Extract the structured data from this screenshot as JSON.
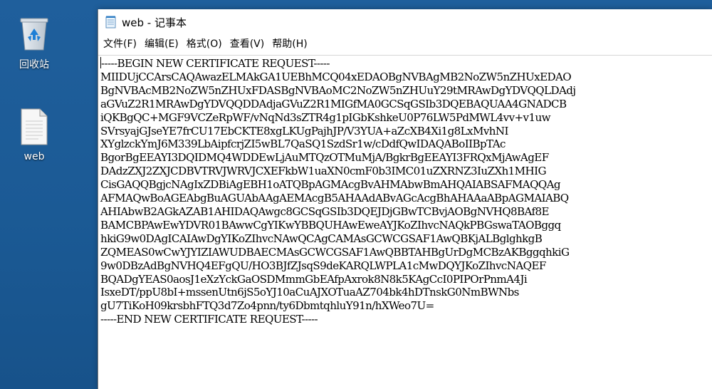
{
  "desktop": {
    "icons": [
      {
        "label": "回收站",
        "icon": "recycle-bin-icon"
      },
      {
        "label": "web",
        "icon": "text-file-icon"
      }
    ]
  },
  "window": {
    "title": "web - 记事本",
    "menu": [
      "文件(F)",
      "编辑(E)",
      "格式(O)",
      "查看(V)",
      "帮助(H)"
    ]
  },
  "document": {
    "lines": [
      "-----BEGIN NEW CERTIFICATE REQUEST-----",
      "MIIDUjCCArsCAQAwazELMAkGA1UEBhMCQ04xEDAOBgNVBAgMB2NoZW5nZHUxEDAO",
      "BgNVBAcMB2NoZW5nZHUxFDASBgNVBAoMC2NoZW5nZHUuY29tMRAwDgYDVQQLDAdj",
      "aGVuZ2R1MRAwDgYDVQQDDAdjaGVuZ2R1MIGfMA0GCSqGSIb3DQEBAQUAA4GNADCB",
      "iQKBgQC+MGF9VCZeRpWF/vNqNd3sZTR4g1pIGbKshkeU0P76LW5PdMWL4vv+v1uw",
      "SVrsyajGJseYE7frCU17EbCKTE8xgLKUgPajhJP/V3YUA+aZcXB4Xi1g8LxMvhNI",
      "XYglzckYmJ6M339LbAipfcrjZI5wBL7QaSQ1SzdSr1w/cDdfQwIDAQABoIIBpTAc",
      "BgorBgEEAYI3DQIDMQ4WDDEwLjAuMTQzOTMuMjA/BgkrBgEEAYI3FRQxMjAwAgEF",
      "DAdzZXJ2ZXJCDBVTRVJWRVJCXEFkbW1uaXN0cmF0b3IMC01uZXRNZ3IuZXh1MHIG",
      "CisGAQQBgjcNAgIxZDBiAgEBH1oATQBpAGMAcgBvAHMAbwBmAHQAIABSAFMAQQAg",
      "AFMAQwBoAGEAbgBuAGUAbAAgAEMAcgB5AHAAdABvAGcAcgBhAHAAaABpAGMAIABQ",
      "AHIAbwB2AGkAZAB1AHIDAQAwgc8GCSqGSIb3DQEJDjGBwTCBvjAOBgNVHQ8BAf8E",
      "BAMCBPAwEwYDVR01BAwwCgYIKwYBBQUHAwEweAYJKoZIhvcNAQkPBGswaTAOBggq",
      "hkiG9w0DAgICAIAwDgYIKoZIhvcNAwQCAgCAMAsGCWCGSAF1AwQBKjALBglghkgB",
      "ZQMEAS0wCwYJYIZIAWUDBAECMAsGCWCGSAF1AwQBBTAHBgUrDgMCBzAKBggqhkiG",
      "9w0DBzAdBgNVHQ4EFgQU/HO3BJfZJsqS9deKARQLWPLA1cMwDQYJKoZIhvcNAQEF",
      "BQADgYEAS0aosJ1eXzYckGaOSDMmmGbEAfpAxrok8N8k5KAgCcI0PIPOrPnmA4Ji",
      "IsxeDT/ppU8bI+mssenUtn6jS5oYJ10aCuAJXOTuaAZ704bk4hDTnskG0NmBWNbs",
      "gU7TiKoH09krsbhFTQ3d7Zo4pnn/ty6DbmtqhluY91n/hXWeo7U=",
      "-----END NEW CERTIFICATE REQUEST-----"
    ]
  }
}
